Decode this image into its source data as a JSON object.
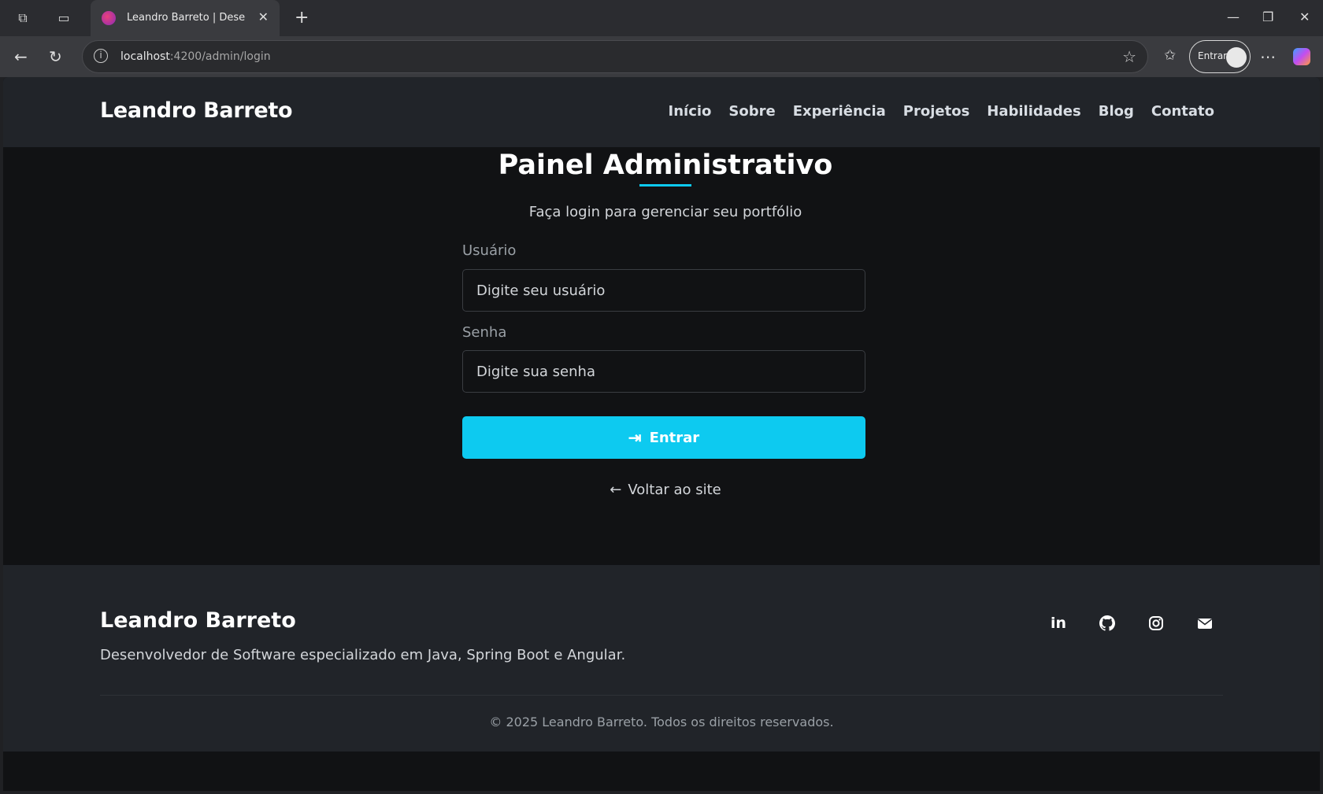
{
  "browser": {
    "tab_title": "Leandro Barreto | Desenvolvedor",
    "url_host": "localhost",
    "url_rest": ":4200/admin/login",
    "profile_label": "Entrar"
  },
  "header": {
    "brand": "Leandro Barreto",
    "menu": [
      "Início",
      "Sobre",
      "Experiência",
      "Projetos",
      "Habilidades",
      "Blog",
      "Contato"
    ]
  },
  "login": {
    "title": "Painel Administrativo",
    "subtitle": "Faça login para gerenciar seu portfólio",
    "username_label": "Usuário",
    "username_placeholder": "Digite seu usuário",
    "password_label": "Senha",
    "password_placeholder": "Digite sua senha",
    "submit_label": "Entrar",
    "back_label": "Voltar ao site"
  },
  "footer": {
    "brand": "Leandro Barreto",
    "description": "Desenvolvedor de Software especializado em Java, Spring Boot e Angular.",
    "copyright": "© 2025 Leandro Barreto. Todos os direitos reservados.",
    "socials": [
      "linkedin-icon",
      "github-icon",
      "instagram-icon",
      "email-icon"
    ]
  },
  "colors": {
    "accent": "#0dcaf0",
    "header_bg": "#212429",
    "page_bg": "#111214"
  }
}
